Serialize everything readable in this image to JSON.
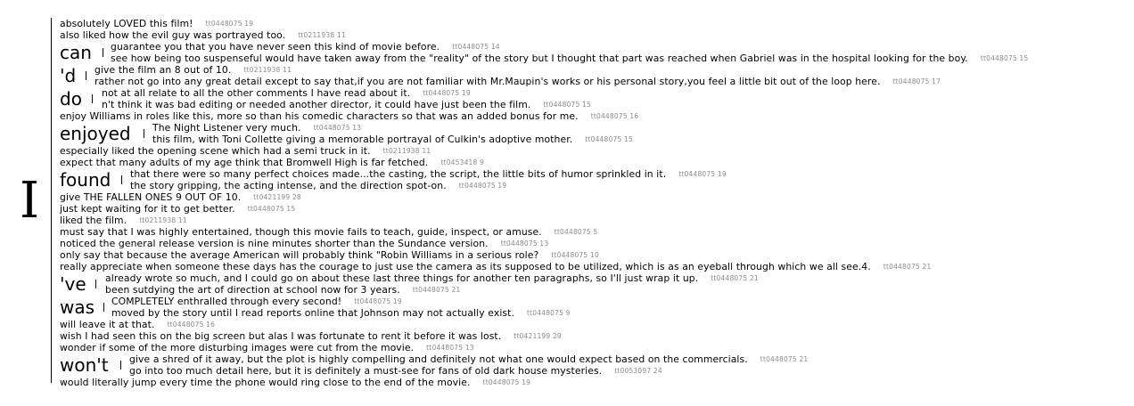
{
  "root_word": "I",
  "lines": [
    {
      "text": "absolutely LOVED this film!",
      "id": "tt0448075 19"
    },
    {
      "text": "also liked how the evil guy was portrayed too.",
      "id": "tt0211938 11"
    },
    {
      "group": "can",
      "items": [
        {
          "text": "guarantee you that you have never seen this kind of movie before.",
          "id": "tt0448075 14"
        },
        {
          "text": "see how being too suspenseful would have taken away from the \"reality\" of the story but I thought that part was reached when Gabriel was in the hospital looking for the boy.",
          "id": "tt0448075 15"
        }
      ]
    },
    {
      "group": "'d",
      "items": [
        {
          "text": "give the film an 8 out of 10.",
          "id": "tt0211938 11"
        },
        {
          "text": "rather not go into any great detail except to say that,if you are not familiar with Mr.Maupin's works or his personal story,you feel a little bit out of the loop here.",
          "id": "tt0448075 17"
        }
      ]
    },
    {
      "group": "do",
      "items": [
        {
          "text": "not at all relate to all the other comments I have read about it.",
          "id": "tt0448075 19"
        },
        {
          "text": "n't think it was bad editing or needed another director, it could have just been the film.",
          "id": "tt0448075 15"
        }
      ]
    },
    {
      "text": "enjoy Williams in roles like this, more so than his comedic characters so that was an added bonus for me.",
      "id": "tt0448075 16"
    },
    {
      "group": "enjoyed",
      "items": [
        {
          "text": "The Night Listener very much.",
          "id": "tt0448075 13"
        },
        {
          "text": "this film, with Toni Collette giving a memorable portrayal of Culkin's adoptive mother.",
          "id": "tt0448075 15"
        }
      ]
    },
    {
      "text": "especially liked the opening scene which had a semi truck in it.",
      "id": "tt0211938 11"
    },
    {
      "text": "expect that many adults of my age think that Bromwell High is far fetched.",
      "id": "tt0453418 9"
    },
    {
      "group": "found",
      "items": [
        {
          "text": "that there were so many perfect choices made...the casting, the script, the little bits of humor sprinkled in it.",
          "id": "tt0448075 19"
        },
        {
          "text": "the story gripping, the acting intense, and the direction spot-on.",
          "id": "tt0448075 19"
        }
      ]
    },
    {
      "text": "give THE FALLEN ONES 9 OUT OF 10.",
      "id": "tt0421199 28"
    },
    {
      "text": "just kept waiting for it to get better.",
      "id": "tt0448075 15"
    },
    {
      "text": "liked the film.",
      "id": "tt0211938 11"
    },
    {
      "text": "must say that I was highly entertained, though this movie fails to teach, guide, inspect, or amuse.",
      "id": "tt0448075 5"
    },
    {
      "text": "noticed the general release version is nine minutes shorter than the Sundance version.",
      "id": "tt0448075 13"
    },
    {
      "text": "only say that because the average American will probably think \"Robin Williams in a serious role?",
      "id": "tt0448075 10"
    },
    {
      "text": "really appreciate when someone these days has the courage to just use the camera as its supposed to be utilized, which is as an eyeball through which we all see.4.",
      "id": "tt0448075 21"
    },
    {
      "group": "'ve",
      "items": [
        {
          "text": "already wrote so much, and I could go on about these last three things for another ten paragraphs, so I'll just wrap it up.",
          "id": "tt0448075 21"
        },
        {
          "text": "been sutdying the art of direction at school now for 3 years.",
          "id": "tt0448075 21"
        }
      ]
    },
    {
      "group": "was",
      "items": [
        {
          "text": "COMPLETELY enthralled through every second!",
          "id": "tt0448075 19"
        },
        {
          "text": "moved by the story until I read reports online that Johnson may not actually exist.",
          "id": "tt0448075 9"
        }
      ]
    },
    {
      "text": "will leave it at that.",
      "id": "tt0448075 16"
    },
    {
      "text": "wish I had seen this on the big screen but alas I was fortunate to rent it before it was lost.",
      "id": "tt0421199 29"
    },
    {
      "text": "wonder if some of the more disturbing images were cut from the movie.",
      "id": "tt0448075 13"
    },
    {
      "group": "won't",
      "items": [
        {
          "text": "give a shred of it away, but the plot is highly compelling and definitely not what one would expect based on the commercials.",
          "id": "tt0448075 21"
        },
        {
          "text": "go into too much detail here, but it is definitely a must-see for fans of old dark house mysteries.",
          "id": "tt0053097 24"
        }
      ]
    },
    {
      "text": "would literally jump every time the phone would ring close to the end of the movie.",
      "id": "tt0448075 19"
    }
  ]
}
